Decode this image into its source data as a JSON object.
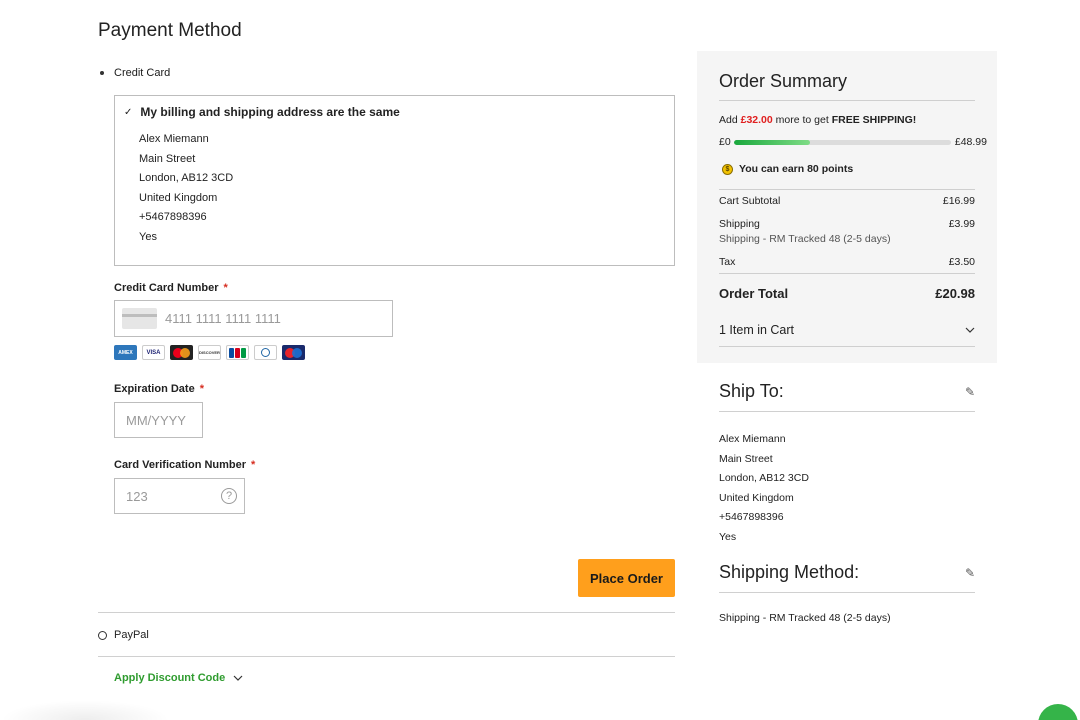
{
  "payment": {
    "title": "Payment Method",
    "credit_card_label": "Credit Card",
    "billing_same_label": "My billing and shipping address are the same",
    "billing_address": [
      "Alex Miemann",
      "Main Street",
      "London, AB12 3CD",
      "United Kingdom",
      "+5467898396",
      "Yes"
    ],
    "card_number_label": "Credit Card Number",
    "card_number_placeholder": "4111 1111 1111 1111",
    "card_brands": [
      "amex",
      "visa",
      "mastercard",
      "discover",
      "jcb",
      "diners",
      "maestro"
    ],
    "expiration_label": "Expiration Date",
    "expiration_placeholder": "MM/YYYY",
    "cvv_label": "Card Verification Number",
    "cvv_placeholder": "123",
    "required_mark": "*",
    "place_order_label": "Place Order",
    "paypal_label": "PayPal",
    "discount_label": "Apply Discount Code"
  },
  "summary": {
    "title": "Order Summary",
    "free_ship_prefix": "Add",
    "free_ship_amount": "£32.00",
    "free_ship_middle": "more to get",
    "free_ship_suffix": "FREE SHIPPING!",
    "progress_min": "£0",
    "progress_max": "£48.99",
    "progress_fraction": 0.35,
    "points_text": "You can earn",
    "points_value": "80 points",
    "cart_subtotal_label": "Cart Subtotal",
    "cart_subtotal_value": "£16.99",
    "shipping_label": "Shipping",
    "shipping_value": "£3.99",
    "shipping_detail": "Shipping - RM Tracked 48 (2-5 days)",
    "tax_label": "Tax",
    "tax_value": "£3.50",
    "order_total_label": "Order Total",
    "order_total_value": "£20.98",
    "items_in_cart": "1 Item in Cart"
  },
  "ship_to": {
    "title": "Ship To:",
    "address": [
      "Alex Miemann",
      "Main Street",
      "London, AB12 3CD",
      "United Kingdom",
      "+5467898396",
      "Yes"
    ]
  },
  "shipping_method": {
    "title": "Shipping Method:",
    "value": "Shipping - RM Tracked 48 (2-5 days)"
  },
  "colors": {
    "accent_orange": "#ff9f1c",
    "discount_green": "#2f9c2f",
    "price_red": "#e02020",
    "progress_green": "#1aa83d"
  }
}
